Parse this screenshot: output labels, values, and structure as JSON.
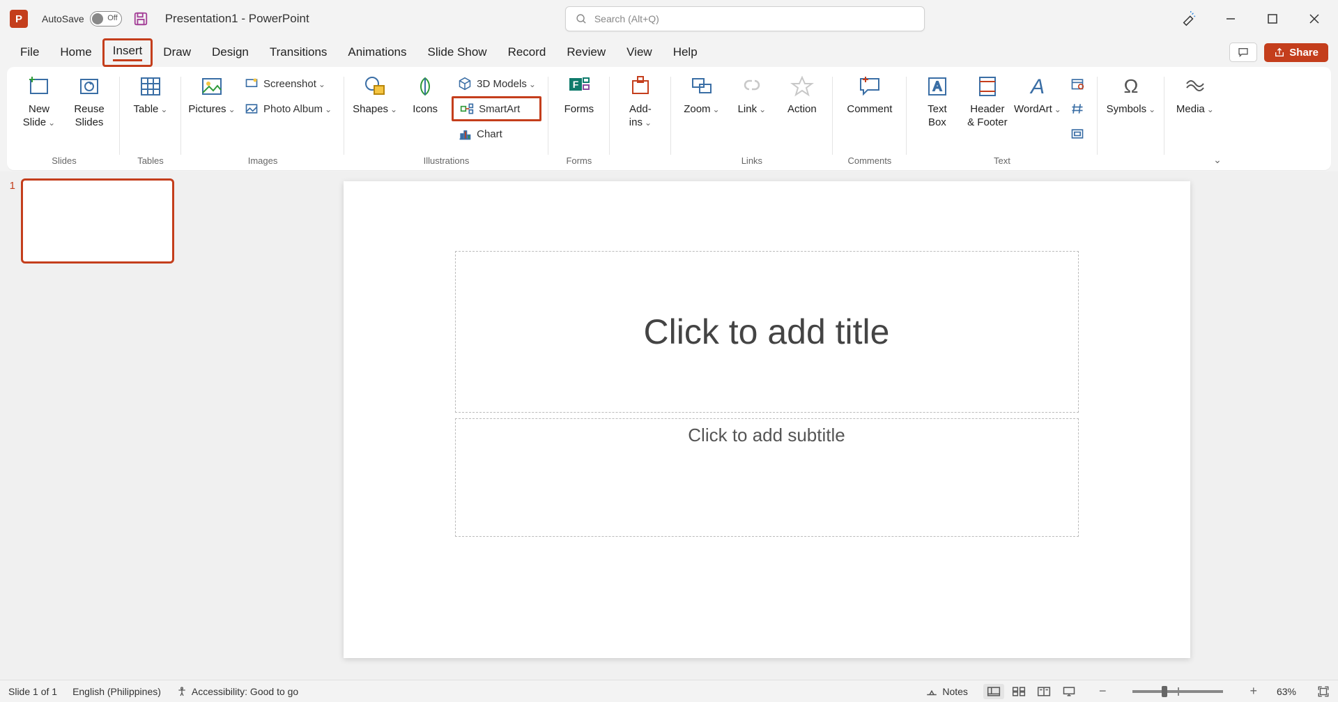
{
  "title": {
    "autosave": "AutoSave",
    "autosave_state": "Off",
    "document": "Presentation1  -  PowerPoint"
  },
  "search": {
    "placeholder": "Search (Alt+Q)"
  },
  "tabs": {
    "file": "File",
    "home": "Home",
    "insert": "Insert",
    "draw": "Draw",
    "design": "Design",
    "transitions": "Transitions",
    "animations": "Animations",
    "slideshow": "Slide Show",
    "record": "Record",
    "review": "Review",
    "view": "View",
    "help": "Help"
  },
  "tabs_right": {
    "share": "Share"
  },
  "ribbon": {
    "slides": {
      "new_slide": "New\nSlide",
      "reuse": "Reuse\nSlides",
      "label": "Slides"
    },
    "tables": {
      "table": "Table",
      "label": "Tables"
    },
    "images": {
      "pictures": "Pictures",
      "screenshot": "Screenshot",
      "photo_album": "Photo Album",
      "label": "Images"
    },
    "illustrations": {
      "shapes": "Shapes",
      "icons": "Icons",
      "models": "3D Models",
      "smartart": "SmartArt",
      "chart": "Chart",
      "label": "Illustrations"
    },
    "forms": {
      "forms": "Forms",
      "label": "Forms"
    },
    "addins": {
      "addins": "Add-\nins",
      "label": ""
    },
    "links": {
      "zoom": "Zoom",
      "link": "Link",
      "action": "Action",
      "label": "Links"
    },
    "comments": {
      "comment": "Comment",
      "label": "Comments"
    },
    "text": {
      "textbox": "Text\nBox",
      "header": "Header\n& Footer",
      "wordart": "WordArt",
      "label": "Text"
    },
    "symbols": {
      "symbols": "Symbols",
      "label": ""
    },
    "media": {
      "media": "Media",
      "label": ""
    }
  },
  "slide": {
    "title_placeholder": "Click to add title",
    "subtitle_placeholder": "Click to add subtitle",
    "thumb_number": "1"
  },
  "status": {
    "slide_info": "Slide 1 of 1",
    "language": "English (Philippines)",
    "accessibility": "Accessibility: Good to go",
    "notes": "Notes",
    "zoom": "63%"
  }
}
